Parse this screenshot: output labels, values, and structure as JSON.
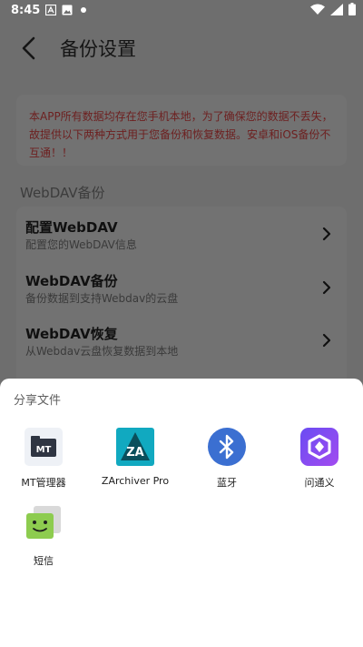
{
  "status_bar": {
    "time": "8:45"
  },
  "header": {
    "title": "备份设置"
  },
  "notice": {
    "text": "本APP所有数据均存在您手机本地，为了确保您的数据不丢失，故提供以下两种方式用于您备份和恢复数据。安卓和iOS备份不互通！！"
  },
  "section": {
    "label": "WebDAV备份"
  },
  "settings": [
    {
      "title": "配置WebDAV",
      "subtitle": "配置您的WebDAV信息"
    },
    {
      "title": "WebDAV备份",
      "subtitle": "备份数据到支持Webdav的云盘"
    },
    {
      "title": "WebDAV恢复",
      "subtitle": "从Webdav云盘恢复数据到本地"
    }
  ],
  "share_sheet": {
    "title": "分享文件",
    "targets": [
      {
        "label": "MT管理器",
        "icon": "mt-manager-icon"
      },
      {
        "label": "ZArchiver Pro",
        "icon": "zarchiver-icon"
      },
      {
        "label": "蓝牙",
        "icon": "bluetooth-icon"
      },
      {
        "label": "问通义",
        "icon": "tongyi-icon"
      },
      {
        "label": "短信",
        "icon": "messages-icon"
      }
    ]
  },
  "colors": {
    "notice_text": "#6d1f1f",
    "bluetooth": "#3b6fd1",
    "zarchiver": "#11a9c0",
    "tongyi": "#7a5cf0",
    "messages": "#8dcc4f"
  }
}
